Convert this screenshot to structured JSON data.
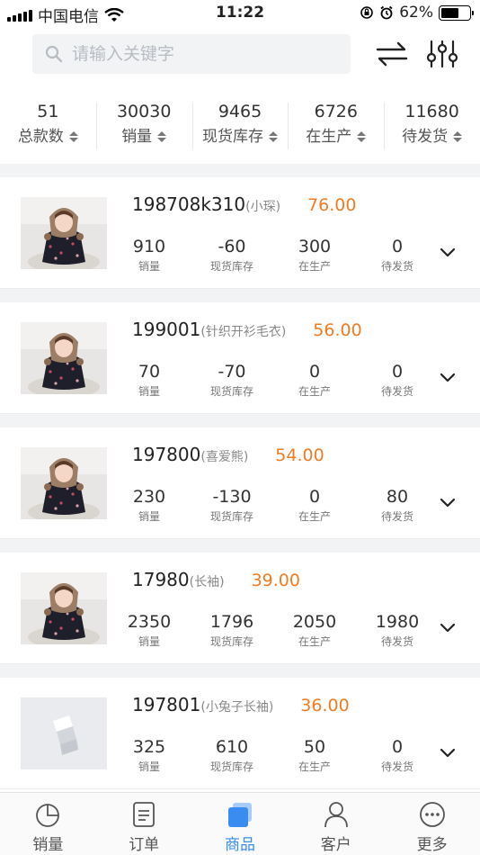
{
  "status_bar": {
    "carrier": "中国电信",
    "time": "11:22",
    "battery": "62%",
    "battery_level": 0.62
  },
  "search": {
    "placeholder": "请输入关键字",
    "value": ""
  },
  "stats": [
    {
      "value": "51",
      "label": "总款数"
    },
    {
      "value": "30030",
      "label": "销量"
    },
    {
      "value": "9465",
      "label": "现货库存"
    },
    {
      "value": "6726",
      "label": "在生产"
    },
    {
      "value": "11680",
      "label": "待发货"
    }
  ],
  "products": [
    {
      "code": "198708k310",
      "name": "(小琛)",
      "price": "76.00",
      "image": "photo",
      "metrics": [
        {
          "value": "910",
          "label": "销量"
        },
        {
          "value": "-60",
          "label": "现货库存"
        },
        {
          "value": "300",
          "label": "在生产"
        },
        {
          "value": "0",
          "label": "待发货"
        }
      ]
    },
    {
      "code": "199001",
      "name": "(针织开衫毛衣)",
      "price": "56.00",
      "image": "photo",
      "metrics": [
        {
          "value": "70",
          "label": "销量"
        },
        {
          "value": "-70",
          "label": "现货库存"
        },
        {
          "value": "0",
          "label": "在生产"
        },
        {
          "value": "0",
          "label": "待发货"
        }
      ]
    },
    {
      "code": "197800",
      "name": "(喜爱熊)",
      "price": "54.00",
      "image": "photo",
      "metrics": [
        {
          "value": "230",
          "label": "销量"
        },
        {
          "value": "-130",
          "label": "现货库存"
        },
        {
          "value": "0",
          "label": "在生产"
        },
        {
          "value": "80",
          "label": "待发货"
        }
      ]
    },
    {
      "code": "17980",
      "name": "(长袖)",
      "price": "39.00",
      "image": "photo",
      "metrics": [
        {
          "value": "2350",
          "label": "销量"
        },
        {
          "value": "1796",
          "label": "现货库存"
        },
        {
          "value": "2050",
          "label": "在生产"
        },
        {
          "value": "1980",
          "label": "待发货"
        }
      ]
    },
    {
      "code": "197801",
      "name": "(小兔子长袖)",
      "price": "36.00",
      "image": "placeholder",
      "metrics": [
        {
          "value": "325",
          "label": "销量"
        },
        {
          "value": "610",
          "label": "现货库存"
        },
        {
          "value": "50",
          "label": "在生产"
        },
        {
          "value": "0",
          "label": "待发货"
        }
      ]
    }
  ],
  "tabbar": [
    {
      "label": "销量",
      "icon": "pie-chart-icon",
      "active": false
    },
    {
      "label": "订单",
      "icon": "order-list-icon",
      "active": false
    },
    {
      "label": "商品",
      "icon": "product-icon",
      "active": true
    },
    {
      "label": "客户",
      "icon": "customer-icon",
      "active": false
    },
    {
      "label": "更多",
      "icon": "more-icon",
      "active": false
    }
  ],
  "colors": {
    "price": "#f07c22",
    "active_tab": "#3b8cf0",
    "background_band": "#f2f3f5"
  }
}
